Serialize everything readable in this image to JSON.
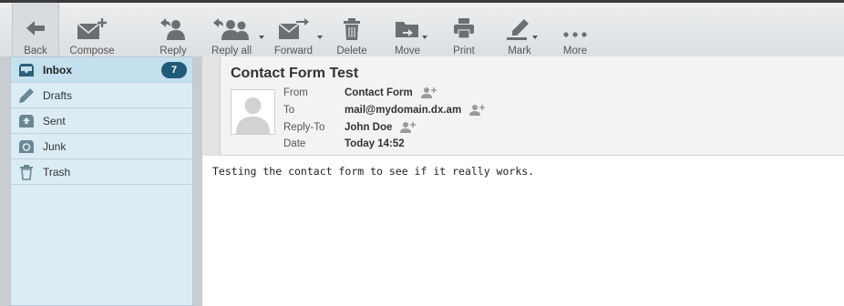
{
  "toolbar": {
    "back": "Back",
    "compose": "Compose",
    "reply": "Reply",
    "reply_all": "Reply all",
    "forward": "Forward",
    "delete": "Delete",
    "move": "Move",
    "print": "Print",
    "mark": "Mark",
    "more": "More"
  },
  "folders": [
    {
      "label": "Inbox",
      "icon": "inbox-icon",
      "unread": "7",
      "selected": true
    },
    {
      "label": "Drafts",
      "icon": "pencil-icon"
    },
    {
      "label": "Sent",
      "icon": "sent-icon"
    },
    {
      "label": "Junk",
      "icon": "junk-icon"
    },
    {
      "label": "Trash",
      "icon": "trash-icon"
    }
  ],
  "message": {
    "subject": "Contact Form Test",
    "from_label": "From",
    "from": "Contact Form",
    "to_label": "To",
    "to": "mail@mydomain.dx.am",
    "reply_to_label": "Reply-To",
    "reply_to": "John Doe",
    "date_label": "Date",
    "date": "Today 14:52",
    "body": "Testing the contact form to see if it really works."
  },
  "colors": {
    "badge": "#1e5b78",
    "sidebar_bg": "#dcecf4",
    "selected_folder": "#c5e0ee",
    "toolbar_bg": "#e4e6e9",
    "icon": "#6b6f73"
  }
}
